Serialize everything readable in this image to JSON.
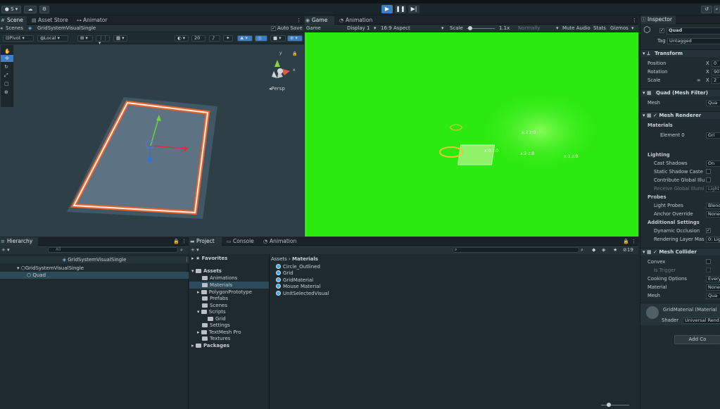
{
  "colors": {
    "accent": "#3c7ec6",
    "game_bg": "#2bea10",
    "border_orange": "#e8622a"
  },
  "toolbar": {
    "account_label": "S",
    "play_icon": "play-icon",
    "pause_icon": "pause-icon",
    "step_icon": "step-icon"
  },
  "scene_tabs": [
    {
      "label": "Scene",
      "icon": "grid-icon"
    },
    {
      "label": "Asset Store",
      "icon": "store-icon"
    },
    {
      "label": "Animator",
      "icon": "animator-icon"
    }
  ],
  "breadcrumb": {
    "root": "Scenes",
    "current": "GridSystemVisualSingle",
    "auto_save": "Auto Save"
  },
  "scene_toolbar": {
    "pivot": "Pivot",
    "local": "Local",
    "grid_value": "20"
  },
  "scene_view": {
    "persp_label": "Persp",
    "gizmo_y": "y",
    "gizmo_x": "x"
  },
  "game_tabs": [
    {
      "label": "Game",
      "icon": "game-icon"
    },
    {
      "label": "Animation",
      "icon": "animation-icon"
    }
  ],
  "game_toolbar": {
    "display_mode": "Game",
    "display": "Display 1",
    "aspect": "16:9 Aspect",
    "scale_label": "Scale",
    "scale_value": "1.1x",
    "normally": "Normally",
    "mute": "Mute Audio",
    "stats": "Stats",
    "gizmos": "Gizmos"
  },
  "game_view": {
    "texts": [
      "x:2 z:0",
      "x:2 z:0",
      "x:3 z:0",
      "x:0 z:0"
    ]
  },
  "inspector": {
    "tab": "Inspector",
    "object_name": "Quad",
    "tag_label": "Tag",
    "tag_value": "Untagged",
    "transform": {
      "title": "Transform",
      "position": "Position",
      "rotation": "Rotation",
      "scale": "Scale",
      "pos_x": "0",
      "rot_x": "90",
      "scale_x": "2",
      "x_label": "X"
    },
    "mesh_filter": {
      "title": "Quad (Mesh Filter)",
      "mesh_label": "Mesh",
      "mesh_value": "Qua"
    },
    "mesh_renderer": {
      "title": "Mesh Renderer",
      "materials": "Materials",
      "element0": "Element 0",
      "element0_value": "Gri"
    },
    "lighting": {
      "title": "Lighting",
      "cast_shadows": "Cast Shadows",
      "cast_value": "On",
      "static_shadow": "Static Shadow Caste",
      "contribute_gi": "Contribute Global Illu",
      "receive_gi": "Receive Global Illumi",
      "receive_value": "Light"
    },
    "probes": {
      "title": "Probes",
      "light_probes": "Light Probes",
      "light_value": "Blend",
      "anchor": "Anchor Override",
      "anchor_value": "None"
    },
    "additional": {
      "title": "Additional Settings",
      "dynamic_occlusion": "Dynamic Occlusion",
      "rendering_layer": "Rendering Layer Mas",
      "rendering_value": "0: Lig"
    },
    "mesh_collider": {
      "title": "Mesh Collider",
      "convex": "Convex",
      "is_trigger": "Is Trigger",
      "cooking": "Cooking Options",
      "cooking_value": "Every",
      "material": "Material",
      "material_value": "None",
      "mesh": "Mesh",
      "mesh_value": "Qua"
    },
    "material_asset": {
      "name": "GridMaterial (Material",
      "shader_label": "Shader",
      "shader_value": "Universal Rend"
    },
    "add_component": "Add Co"
  },
  "hierarchy": {
    "tab": "Hierarchy",
    "search_placeholder": "All",
    "scene_name": "GridSystemVisualSingle",
    "items": [
      "GridSystemVisualSingle",
      "Quad"
    ]
  },
  "project_tabs": [
    {
      "label": "Project",
      "icon": "folder-icon"
    },
    {
      "label": "Console",
      "icon": "console-icon"
    },
    {
      "label": "Animation",
      "icon": "animation-icon"
    }
  ],
  "project": {
    "hidden_count": "19",
    "favorites": "Favorites",
    "assets_root": "Assets",
    "tree": [
      "Animations",
      "Materials",
      "PolygonPrototype",
      "Prefabs",
      "Scenes",
      "Scripts",
      "Grid",
      "Settings",
      "TextMesh Pro",
      "Textures"
    ],
    "packages": "Packages",
    "breadcrumb_root": "Assets",
    "breadcrumb_current": "Materials",
    "files": [
      "Circle_Outlined",
      "Grid",
      "GridMaterial",
      "Mouse Material",
      "UnitSelectedVisual"
    ]
  }
}
